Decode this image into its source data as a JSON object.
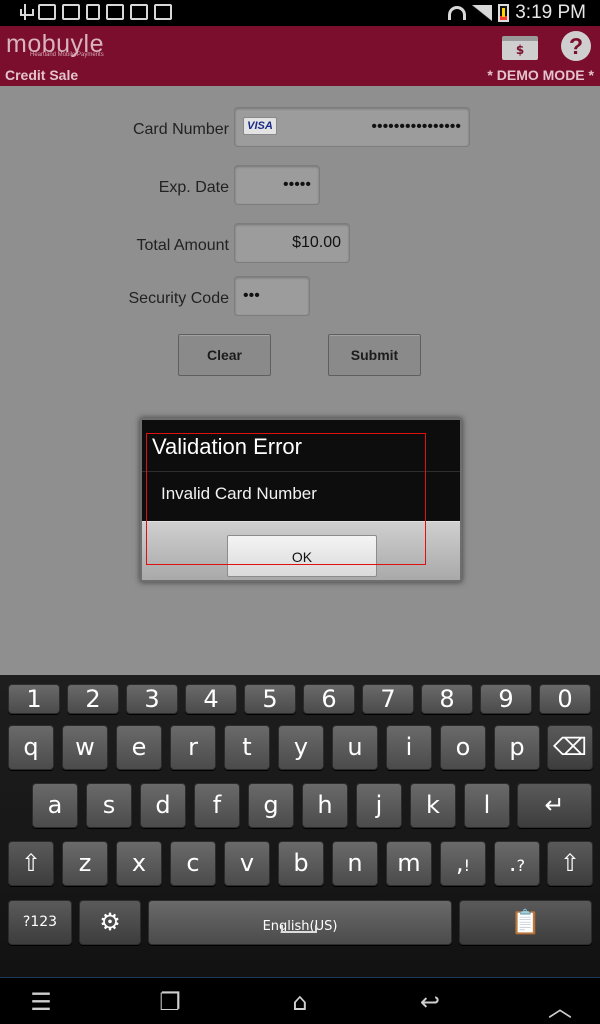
{
  "status_bar": {
    "time": "3:19 PM",
    "icons": [
      "usb-icon",
      "keyboard-icon",
      "sync-icon",
      "sd-card-icon",
      "mail-icon",
      "clipboard-check-icon",
      "download-icon"
    ],
    "right_icons": [
      "wifi-icon",
      "signal-icon",
      "battery-icon"
    ]
  },
  "header": {
    "logo": "mobuyle",
    "logo_subtitle": "Heartland Mobile Payments",
    "section_title": "Credit Sale",
    "mode": "* DEMO MODE *",
    "cash_label": "$",
    "help_label": "?",
    "brand_color": "#7a0e2c"
  },
  "form": {
    "card_number_label": "Card Number",
    "card_brand": "VISA",
    "card_number_value": "••••••••••••••••",
    "exp_date_label": "Exp. Date",
    "exp_date_value": "•••••",
    "total_amount_label": "Total Amount",
    "total_amount_value": "$10.00",
    "security_code_label": "Security Code",
    "security_code_value": "•••",
    "clear_label": "Clear",
    "submit_label": "Submit"
  },
  "dialog": {
    "title": "Validation Error",
    "message": "Invalid Card Number",
    "ok_label": "OK"
  },
  "keyboard": {
    "numbers": [
      "1",
      "2",
      "3",
      "4",
      "5",
      "6",
      "7",
      "8",
      "9",
      "0"
    ],
    "row1": [
      "q",
      "w",
      "e",
      "r",
      "t",
      "y",
      "u",
      "i",
      "o",
      "p"
    ],
    "row2": [
      "a",
      "s",
      "d",
      "f",
      "g",
      "h",
      "j",
      "k",
      "l"
    ],
    "row3": [
      "z",
      "x",
      "c",
      "v",
      "b",
      "n",
      "m"
    ],
    "comma_key": ",",
    "comma_alt": "!",
    "period_key": ".",
    "period_alt": "?",
    "symbols_label": "?123",
    "space_language": "English(US)"
  },
  "nav_bar": {
    "icons": [
      "menu-icon",
      "recent-apps-icon",
      "home-icon",
      "back-icon",
      "hide-keyboard-icon"
    ]
  }
}
